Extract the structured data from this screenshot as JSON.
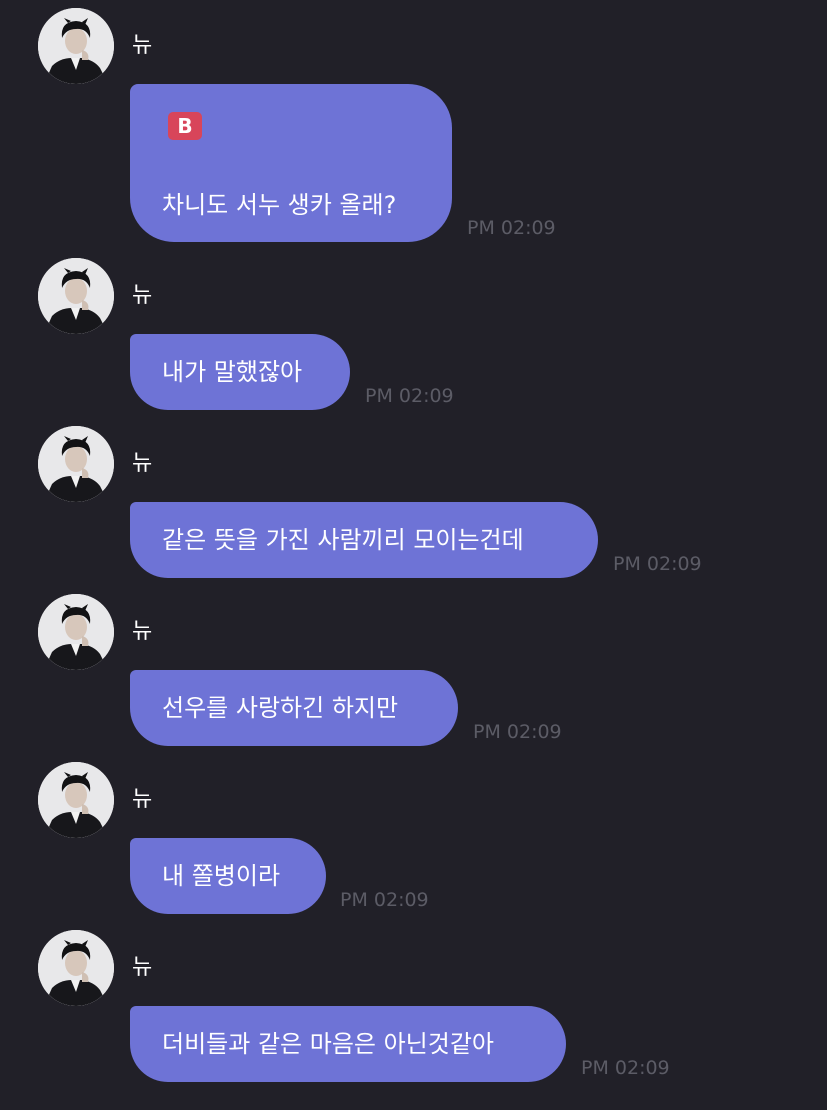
{
  "messages": [
    {
      "sender": "뉴",
      "badge": "B",
      "text": "차니도 서누 생카 올래?",
      "time": "PM 02:09"
    },
    {
      "sender": "뉴",
      "text": "내가 말했잖아",
      "time": "PM 02:09"
    },
    {
      "sender": "뉴",
      "text": "같은 뜻을 가진 사람끼리 모이는건데",
      "time": "PM 02:09"
    },
    {
      "sender": "뉴",
      "text": "선우를 사랑하긴 하지만",
      "time": "PM 02:09"
    },
    {
      "sender": "뉴",
      "text": "내 쫄병이라",
      "time": "PM 02:09"
    },
    {
      "sender": "뉴",
      "text": "더비들과 같은 마음은 아닌것같아",
      "time": "PM 02:09"
    }
  ],
  "colors": {
    "background": "#212028",
    "bubble": "#6e73d6",
    "timestamp": "#5c5c66",
    "badge": "#d8455a"
  },
  "icons": {
    "avatar": "profile-photo",
    "badge": "red-b-emoji"
  }
}
